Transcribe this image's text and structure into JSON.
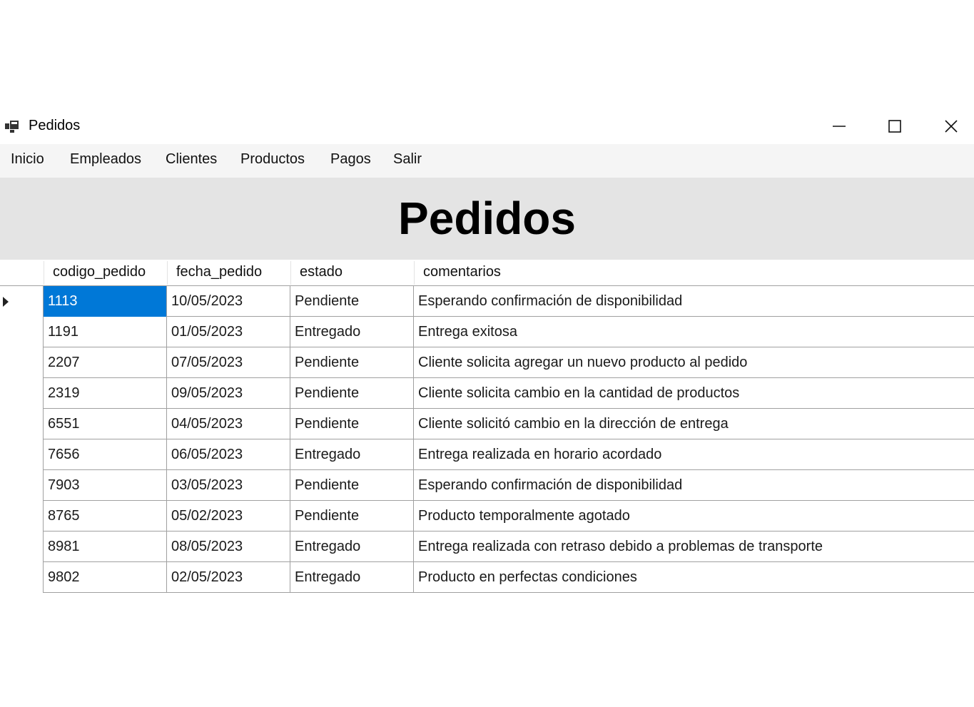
{
  "window": {
    "title": "Pedidos",
    "icon": "app-window-icon"
  },
  "menu": {
    "items": [
      "Inicio",
      "Empleados",
      "Clientes",
      "Productos",
      "Pagos",
      "Salir"
    ]
  },
  "header": {
    "title": "Pedidos"
  },
  "table": {
    "columns": [
      "codigo_pedido",
      "fecha_pedido",
      "estado",
      "comentarios"
    ],
    "selected_row": 0,
    "rows": [
      [
        "1113",
        "10/05/2023",
        "Pendiente",
        "Esperando confirmación de disponibilidad"
      ],
      [
        "1191",
        "01/05/2023",
        "Entregado",
        "Entrega exitosa"
      ],
      [
        "2207",
        "07/05/2023",
        "Pendiente",
        "Cliente solicita agregar un nuevo producto al pedido"
      ],
      [
        "2319",
        "09/05/2023",
        "Pendiente",
        "Cliente solicita cambio en la cantidad de productos"
      ],
      [
        "6551",
        "04/05/2023",
        "Pendiente",
        "Cliente solicitó cambio en la dirección de entrega"
      ],
      [
        "7656",
        "06/05/2023",
        "Entregado",
        "Entrega realizada en horario acordado"
      ],
      [
        "7903",
        "03/05/2023",
        "Pendiente",
        "Esperando confirmación de disponibilidad"
      ],
      [
        "8765",
        "05/02/2023",
        "Pendiente",
        "Producto temporalmente agotado"
      ],
      [
        "8981",
        "08/05/2023",
        "Entregado",
        "Entrega realizada con retraso debido a problemas de transporte"
      ],
      [
        "9802",
        "02/05/2023",
        "Entregado",
        "Producto en perfectas condiciones"
      ]
    ]
  },
  "colors": {
    "selection": "#0078d7",
    "header_panel": "#e4e4e4",
    "menubar": "#f5f5f5"
  }
}
